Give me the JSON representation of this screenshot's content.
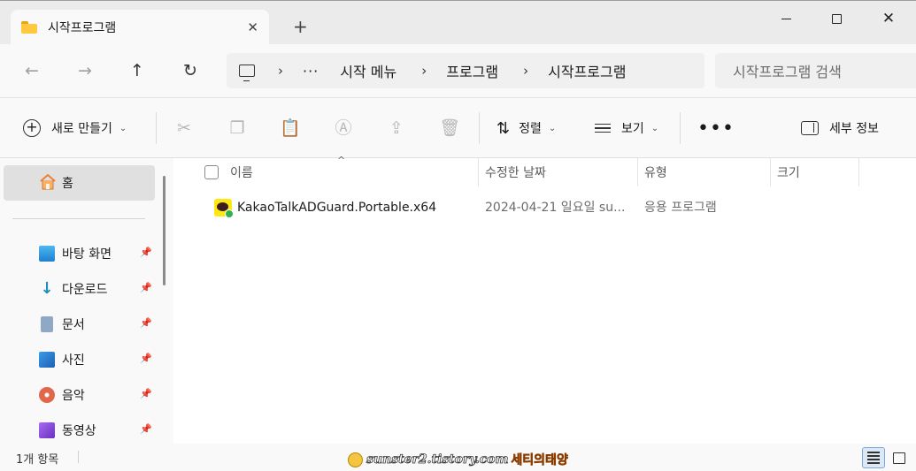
{
  "window": {
    "tab_title": "시작프로그램",
    "tab_close": "✕",
    "new_tab": "+",
    "minimize": "",
    "close": "✕"
  },
  "nav": {
    "back": "←",
    "forward": "→",
    "up": "↑",
    "refresh": "↻",
    "more_crumbs": "···",
    "sep": "›",
    "breadcrumbs": [
      "시작 메뉴",
      "프로그램",
      "시작프로그램"
    ],
    "search_placeholder": "시작프로그램 검색"
  },
  "toolbar": {
    "new_label": "새로 만들기",
    "new_caret": "⌄",
    "icons": {
      "cut": "✂",
      "copy": "❐",
      "paste": "📋",
      "rename": "Ⓐ",
      "share": "⇪",
      "delete": "🗑"
    },
    "sort_label": "정렬",
    "sort_icon": "⇅",
    "view_label": "보기",
    "more_label": "•••",
    "details_label": "세부 정보"
  },
  "sidebar": {
    "home_label": "홈",
    "items": [
      {
        "label": "바탕 화면",
        "icon": "desktop-icon",
        "color": "#2f9be0"
      },
      {
        "label": "다운로드",
        "icon": "download-icon",
        "color": "#1f8fb8"
      },
      {
        "label": "문서",
        "icon": "document-icon",
        "color": "#6d8fb0"
      },
      {
        "label": "사진",
        "icon": "pictures-icon",
        "color": "#2a7fd1"
      },
      {
        "label": "음악",
        "icon": "music-icon",
        "color": "#e0674a"
      },
      {
        "label": "동영상",
        "icon": "video-icon",
        "color": "#8b4ad9"
      }
    ],
    "pin_glyph": "📌"
  },
  "columns": {
    "sort_indicator": "^",
    "name": "이름",
    "date": "수정한 날짜",
    "type": "유형",
    "size": "크기"
  },
  "files": [
    {
      "name": "KakaoTalkADGuard.Portable.x64",
      "date": "2024-04-21 일요일 su...",
      "type": "응용 프로그램",
      "size": ""
    }
  ],
  "status": {
    "item_count": "1개 항목",
    "watermark_site": "sunster2.tistory.com",
    "watermark_name": "세티의태양"
  },
  "colors": {
    "accent": "#2f9be0",
    "selected_nav": "#e0e0e0",
    "kakao_yellow": "#ffe812"
  }
}
